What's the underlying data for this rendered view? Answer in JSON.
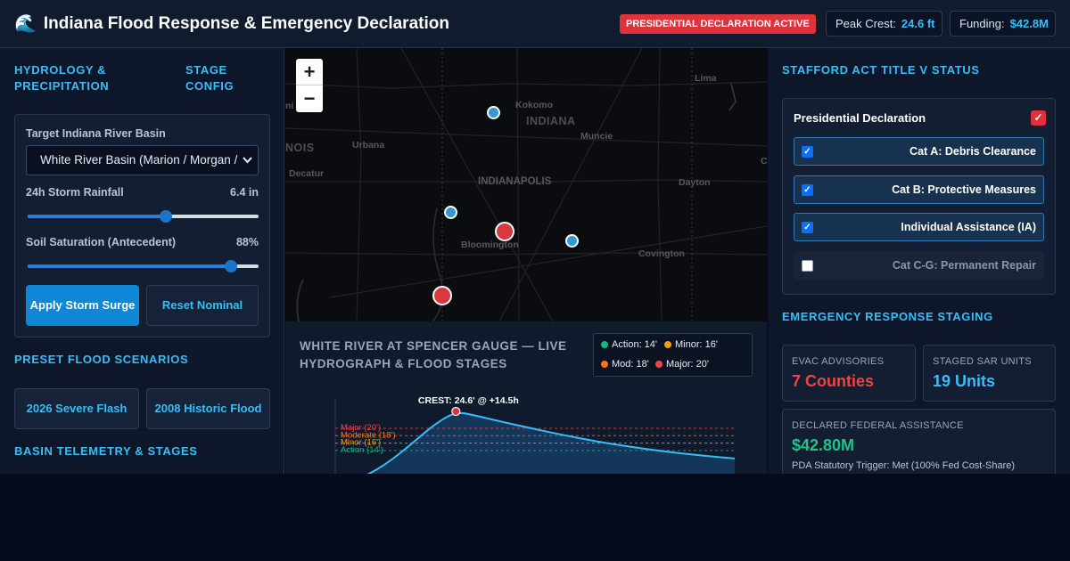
{
  "header": {
    "icon": "wave-icon",
    "title": "Indiana Flood Response & Emergency Declaration",
    "badge": "PRESIDENTIAL DECLARATION ACTIVE",
    "peak_crest_label": "Peak Crest:",
    "peak_crest_value": "24.6 ft",
    "funding_label": "Funding:",
    "funding_value": "$42.8M"
  },
  "left": {
    "tabs": [
      "HYDROLOGY & PRECIPITATION",
      "STAGE CONFIG"
    ],
    "basin_label": "Target Indiana River Basin",
    "basin_value": "White River Basin (Marion / Morgan /",
    "rainfall_label": "24h Storm Rainfall",
    "rainfall_value": "6.4 in",
    "rainfall_fraction": 0.6,
    "soil_label": "Soil Saturation (Antecedent)",
    "soil_value": "88%",
    "soil_fraction": 0.88,
    "apply_button": "Apply Storm Surge",
    "reset_button": "Reset Nominal",
    "scenarios_title": "PRESET FLOOD SCENARIOS",
    "scenario_buttons": [
      "2026 Severe Flash",
      "2008 Historic Flood"
    ],
    "telemetry_title": "BASIN TELEMETRY & STAGES"
  },
  "map": {
    "zoom_in": "+",
    "zoom_out": "−",
    "state_labels": [
      "INDIANA",
      "NOIS"
    ],
    "cities": [
      "Kokomo",
      "Urbana",
      "Muncie",
      "Decatur",
      "INDIANAPOLIS",
      "Dayton",
      "Bloomington",
      "Covington",
      "Lima"
    ],
    "edge_labels": [
      "ni",
      "C"
    ]
  },
  "hydrograph": {
    "title": "WHITE RIVER AT SPENCER GAUGE — LIVE HYDROGRAPH & FLOOD STAGES",
    "legend": [
      {
        "label": "Action: 14'",
        "color": "#10b981"
      },
      {
        "label": "Minor: 16'",
        "color": "#f59e0b"
      },
      {
        "label": "Mod: 18'",
        "color": "#f97316"
      },
      {
        "label": "Major: 20'",
        "color": "#ef4444"
      }
    ],
    "chart_data": {
      "type": "area",
      "title": "",
      "xlabel": "",
      "ylabel": "",
      "x": [
        0,
        2,
        4,
        6,
        8,
        10,
        12,
        14.5,
        17,
        20,
        24,
        28,
        32,
        36,
        40,
        44,
        48
      ],
      "y": [
        5.0,
        5.8,
        7.5,
        10.2,
        13.6,
        17.4,
        21.2,
        24.6,
        23.4,
        21.8,
        19.8,
        17.9,
        16.2,
        14.8,
        13.6,
        12.6,
        11.8
      ],
      "ylim": [
        5,
        28
      ],
      "xlim": [
        0,
        48
      ],
      "thresholds": [
        {
          "label": "Major (20')",
          "value": 20,
          "color": "#ef4444"
        },
        {
          "label": "Moderate (18')",
          "value": 18,
          "color": "#f97316"
        },
        {
          "label": "Minor (16')",
          "value": 16,
          "color": "#f59e0b"
        },
        {
          "label": "Action (14')",
          "value": 14,
          "color": "#10b981"
        }
      ],
      "annotation": "CREST: 24.6' @ +14.5h",
      "crest": {
        "x": 14.5,
        "y": 24.6
      }
    }
  },
  "right": {
    "stafford_title": "STAFFORD ACT TITLE V STATUS",
    "declaration_label": "Presidential Declaration",
    "categories": [
      {
        "label": "Cat A: Debris Clearance",
        "checked": true
      },
      {
        "label": "Cat B: Protective Measures",
        "checked": true
      },
      {
        "label": "Individual Assistance (IA)",
        "checked": true
      },
      {
        "label": "Cat C-G: Permanent Repair",
        "checked": false
      }
    ],
    "staging_title": "EMERGENCY RESPONSE STAGING",
    "evac_label": "EVAC ADVISORIES",
    "evac_value": "7 Counties",
    "sar_label": "STAGED SAR UNITS",
    "sar_value": "19 Units",
    "federal_label": "DECLARED FEDERAL ASSISTANCE",
    "federal_value": "$42.80M",
    "pda_text": "PDA Statutory Trigger: Met (100% Fed Cost-Share)"
  },
  "colors": {
    "accent": "#38bdf8",
    "danger": "#e0323a",
    "success": "#22c08a",
    "primary_button": "#0d87d6"
  }
}
